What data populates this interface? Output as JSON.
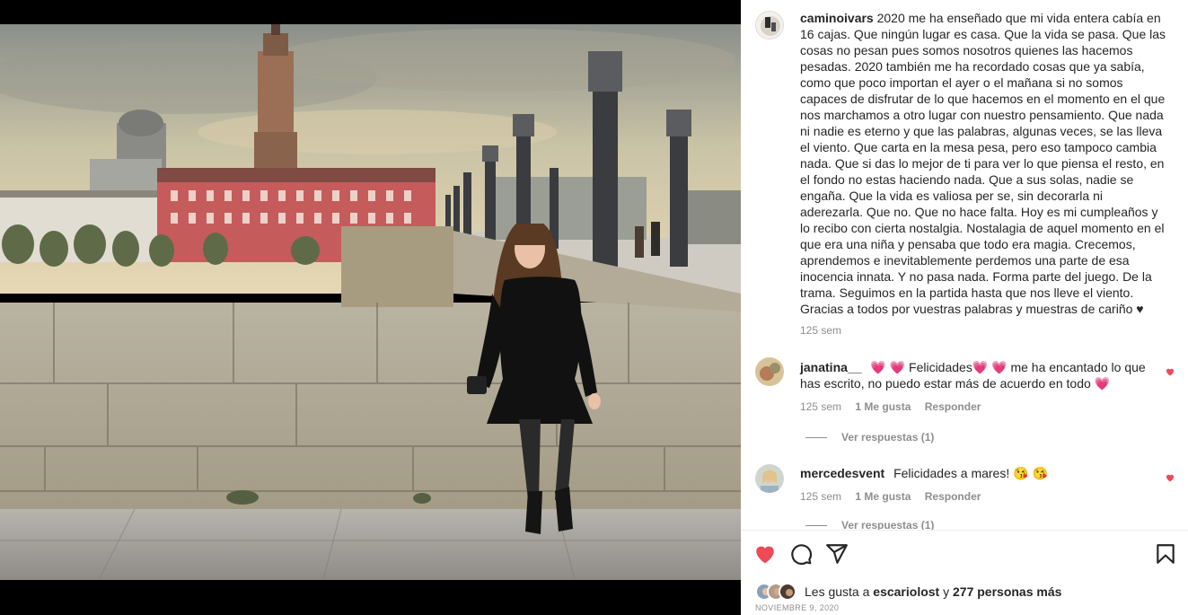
{
  "post": {
    "image_alt": "Mujer sonriendo apoyada en un muro de piedra junto a un puente con farolas y una torre al fondo",
    "author": "caminoivars",
    "caption": "2020 me ha enseñado que mi vida entera cabía en 16 cajas. Que ningún lugar es casa. Que la vida se pasa. Que las cosas no pesan pues somos nosotros quienes las hacemos pesadas. 2020 también me ha recordado cosas que ya sabía, como que poco importan el ayer o el mañana si no somos capaces de disfrutar de lo que hacemos en el momento en el que nos marchamos a otro lugar con nuestro pensamiento. Que nada ni nadie es eterno y que las palabras, algunas veces, se las lleva el viento. Que carta en la mesa pesa, pero eso tampoco cambia nada. Que si das lo mejor de ti para ver lo que piensa el resto, en el fondo no estas haciendo nada. Que a sus solas, nadie se engaña. Que la vida es valiosa per se, sin decorarla ni aderezarla. Que no. Que no hace falta. Hoy es mi cumpleaños y lo recibo con cierta nostalgia. Nostalagia de aquel momento en el que era una niña y pensaba que todo era magia. Crecemos, aprendemos e inevitablemente perdemos una parte de esa inocencia innata. Y no pasa nada. Forma parte del juego. De la trama. Seguimos en la partida hasta que nos lleve el viento. Gracias a todos por vuestras palabras y muestras de cariño ♥",
    "caption_time": "125 sem",
    "liked_by_text": "Les gusta a",
    "liked_by_user": "escariolost",
    "liked_by_and": "y",
    "liked_by_others": "277 personas más",
    "date": "NOVIEMBRE 9, 2020"
  },
  "comments": [
    {
      "user": "janatina__",
      "text": "💗 💗 Felicidades💗 💗  me ha encantado lo que has escrito, no puedo estar más de acuerdo en todo 💗",
      "time": "125 sem",
      "likes": "1 Me gusta",
      "reply": "Responder",
      "view_replies": "Ver respuestas (1)"
    },
    {
      "user": "mercedesvent",
      "text": "Felicidades a mares! 😘 😘",
      "time": "125 sem",
      "likes": "1 Me gusta",
      "reply": "Responder",
      "view_replies": "Ver respuestas (1)"
    }
  ],
  "colors": {
    "like_red": "#ed4956",
    "text": "#262626",
    "muted": "#8e8e8e"
  },
  "icons": {
    "like": "heart-filled-icon",
    "comment": "speech-bubble-icon",
    "share": "paper-plane-icon",
    "save": "bookmark-icon"
  }
}
